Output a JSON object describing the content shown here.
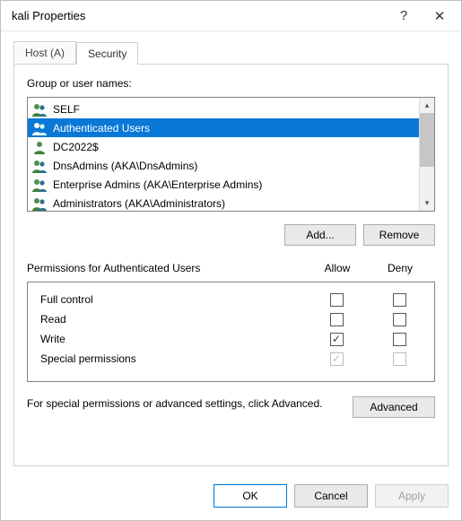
{
  "window": {
    "title": "kali Properties",
    "help_glyph": "?",
    "close_glyph": "✕"
  },
  "tabs": [
    {
      "label": "Host (A)",
      "active": false
    },
    {
      "label": "Security",
      "active": true
    }
  ],
  "group_label": "Group or user names:",
  "principals": [
    {
      "name": "SELF",
      "icon": "pair",
      "selected": false
    },
    {
      "name": "Authenticated Users",
      "icon": "pair",
      "selected": true
    },
    {
      "name": "DC2022$",
      "icon": "single",
      "selected": false
    },
    {
      "name": "DnsAdmins (AKA\\DnsAdmins)",
      "icon": "pair",
      "selected": false
    },
    {
      "name": "Enterprise Admins (AKA\\Enterprise Admins)",
      "icon": "pair",
      "selected": false
    },
    {
      "name": "Administrators (AKA\\Administrators)",
      "icon": "pair",
      "selected": false
    }
  ],
  "buttons": {
    "add": "Add...",
    "remove": "Remove",
    "advanced": "Advanced",
    "ok": "OK",
    "cancel": "Cancel",
    "apply": "Apply"
  },
  "perm_header": {
    "title": "Permissions for Authenticated Users",
    "allow": "Allow",
    "deny": "Deny"
  },
  "permissions": [
    {
      "name": "Full control",
      "allow": false,
      "deny": false,
      "disabled": false
    },
    {
      "name": "Read",
      "allow": false,
      "deny": false,
      "disabled": false
    },
    {
      "name": "Write",
      "allow": true,
      "deny": false,
      "disabled": false
    },
    {
      "name": "Special permissions",
      "allow": true,
      "deny": false,
      "disabled": true
    }
  ],
  "advanced_text": "For special permissions or advanced settings, click Advanced.",
  "scroll": {
    "up": "▴",
    "down": "▾"
  },
  "checkmark": "✓"
}
